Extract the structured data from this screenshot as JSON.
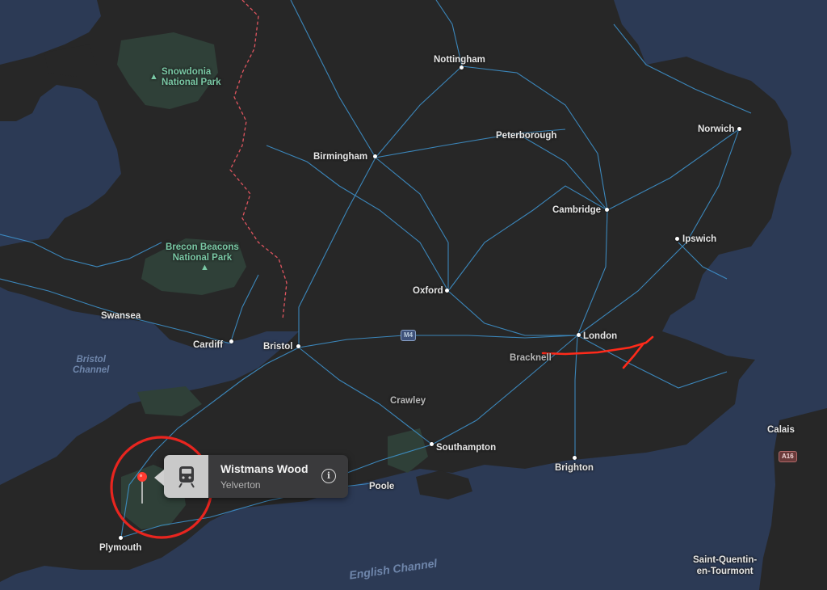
{
  "map": {
    "colors": {
      "water": "#2c3a55",
      "land": "#272727",
      "roads": "#3f97d4",
      "park": "#2f4038",
      "border": "#e0555f",
      "annotation": "#ff2a1a"
    },
    "cities": [
      {
        "name": "Nottingham"
      },
      {
        "name": "Norwich"
      },
      {
        "name": "Peterborough"
      },
      {
        "name": "Birmingham"
      },
      {
        "name": "Cambridge"
      },
      {
        "name": "Ipswich"
      },
      {
        "name": "Swansea"
      },
      {
        "name": "Oxford"
      },
      {
        "name": "London"
      },
      {
        "name": "Cardiff"
      },
      {
        "name": "Bristol"
      },
      {
        "name": "Southampton"
      },
      {
        "name": "Brighton"
      },
      {
        "name": "Plymouth"
      },
      {
        "name": "Poole"
      },
      {
        "name": "Calais"
      },
      {
        "name": "Saint-Quentin-\nen-Tourmont"
      }
    ],
    "minor_places": [
      {
        "name": "Bracknell"
      },
      {
        "name": "Crawley"
      }
    ],
    "parks": [
      {
        "name": "Snowdonia\nNational Park"
      },
      {
        "name": "Brecon Beacons\nNational Park"
      }
    ],
    "water_labels": [
      {
        "name": "Bristol\nChannel"
      },
      {
        "name": "English Channel"
      }
    ],
    "road_shields": [
      {
        "label": "M4"
      },
      {
        "label": "A16"
      }
    ]
  },
  "callout": {
    "title": "Wistmans Wood",
    "subtitle": "Yelverton",
    "icon": "train-icon",
    "info_icon": "info-icon",
    "info_glyph": "i"
  }
}
